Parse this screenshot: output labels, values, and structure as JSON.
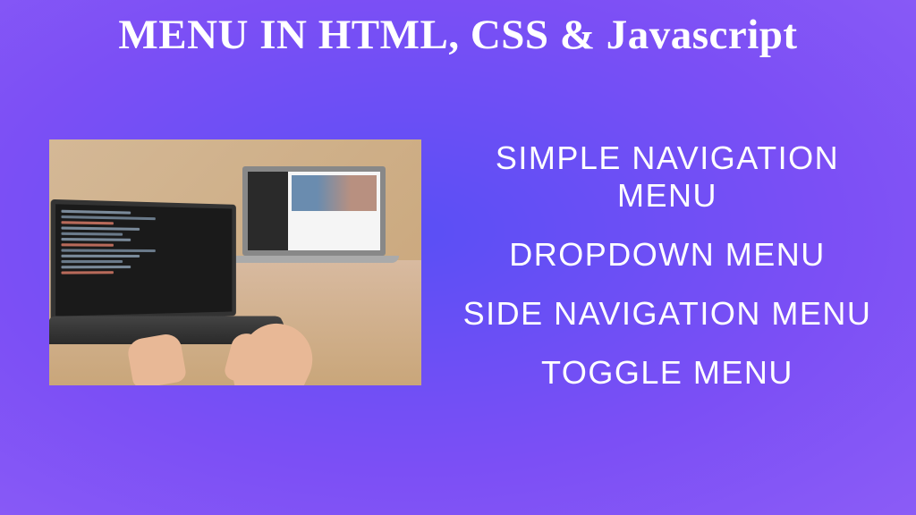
{
  "header": {
    "title": "MENU IN HTML, CSS & Javascript"
  },
  "menu_items": [
    "Simple Navigation Menu",
    "Dropdown Menu",
    "Side Navigation Menu",
    "Toggle Menu"
  ]
}
